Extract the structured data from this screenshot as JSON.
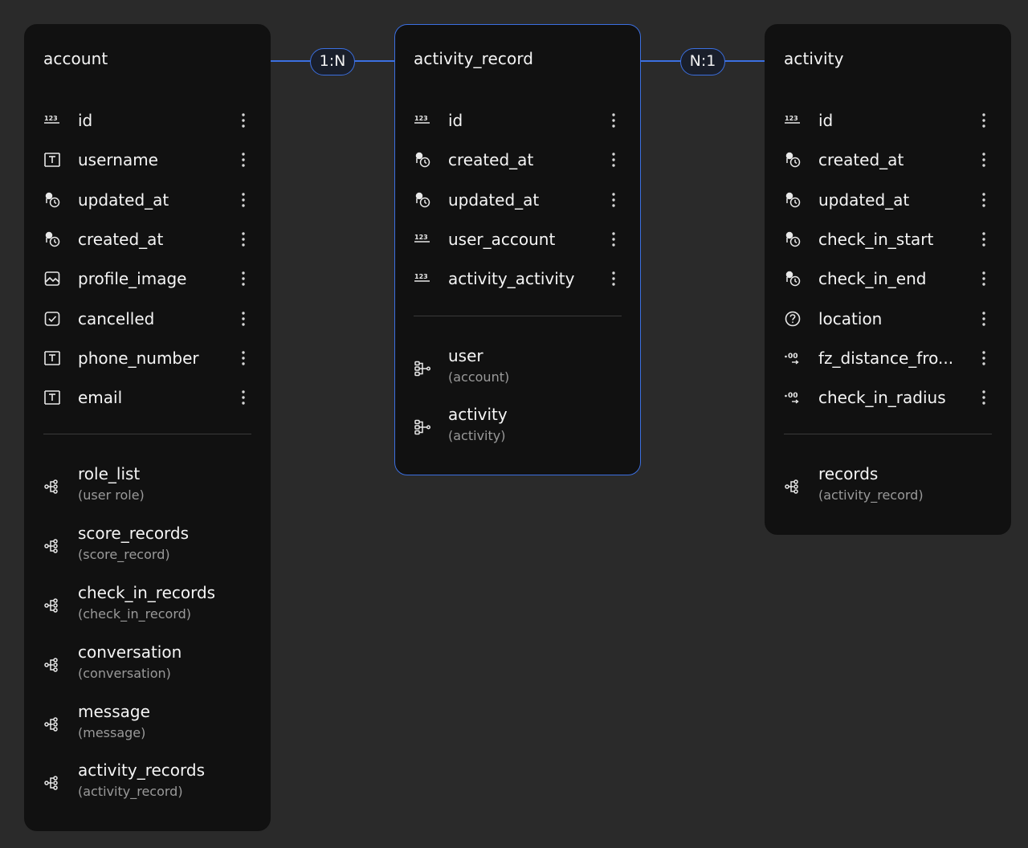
{
  "relations": [
    {
      "label": "1:N"
    },
    {
      "label": "N:1"
    }
  ],
  "tables": {
    "account": {
      "title": "account",
      "fields": [
        {
          "name": "id",
          "icon": "number-icon"
        },
        {
          "name": "username",
          "icon": "text-icon"
        },
        {
          "name": "updated_at",
          "icon": "datetime-icon"
        },
        {
          "name": "created_at",
          "icon": "datetime-icon"
        },
        {
          "name": "profile_image",
          "icon": "image-icon"
        },
        {
          "name": "cancelled",
          "icon": "checkbox-icon"
        },
        {
          "name": "phone_number",
          "icon": "text-icon"
        },
        {
          "name": "email",
          "icon": "text-icon"
        }
      ],
      "relations": [
        {
          "name": "role_list",
          "target": "(user role)",
          "icon": "one-to-many-icon"
        },
        {
          "name": "score_records",
          "target": "(score_record)",
          "icon": "one-to-many-icon"
        },
        {
          "name": "check_in_records",
          "target": "(check_in_record)",
          "icon": "one-to-many-icon"
        },
        {
          "name": "conversation",
          "target": "(conversation)",
          "icon": "one-to-many-icon"
        },
        {
          "name": "message",
          "target": "(message)",
          "icon": "one-to-many-icon"
        },
        {
          "name": "activity_records",
          "target": "(activity_record)",
          "icon": "one-to-many-icon"
        }
      ]
    },
    "activity_record": {
      "title": "activity_record",
      "fields": [
        {
          "name": "id",
          "icon": "number-icon"
        },
        {
          "name": "created_at",
          "icon": "datetime-icon"
        },
        {
          "name": "updated_at",
          "icon": "datetime-icon"
        },
        {
          "name": "user_account",
          "icon": "number-icon"
        },
        {
          "name": "activity_activity",
          "icon": "number-icon"
        }
      ],
      "relations": [
        {
          "name": "user",
          "target": "(account)",
          "icon": "many-to-one-icon"
        },
        {
          "name": "activity",
          "target": "(activity)",
          "icon": "many-to-one-icon"
        }
      ]
    },
    "activity": {
      "title": "activity",
      "fields": [
        {
          "name": "id",
          "icon": "number-icon"
        },
        {
          "name": "created_at",
          "icon": "datetime-icon"
        },
        {
          "name": "updated_at",
          "icon": "datetime-icon"
        },
        {
          "name": "check_in_start",
          "icon": "datetime-icon"
        },
        {
          "name": "check_in_end",
          "icon": "datetime-icon"
        },
        {
          "name": "location",
          "icon": "unknown-type-icon"
        },
        {
          "name": "fz_distance_fro...",
          "icon": "decimal-icon"
        },
        {
          "name": "check_in_radius",
          "icon": "decimal-icon"
        }
      ],
      "relations": [
        {
          "name": "records",
          "target": "(activity_record)",
          "icon": "one-to-many-icon"
        }
      ]
    }
  }
}
